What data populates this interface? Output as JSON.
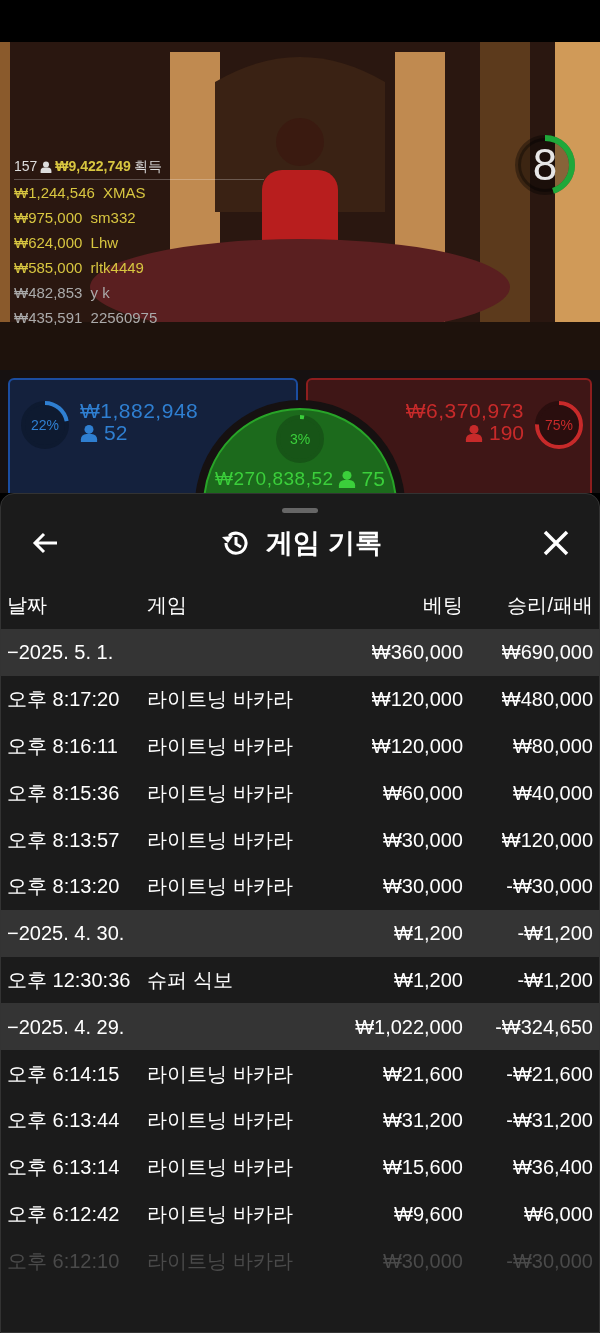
{
  "stream": {
    "timer": {
      "value": "8",
      "level": 0.45
    },
    "leaderboard": {
      "players": "157",
      "total": "₩9,422,749",
      "label": "획득",
      "entries": [
        {
          "amount": "₩1,244,546",
          "name": "XMAS",
          "faded": false
        },
        {
          "amount": "₩975,000",
          "name": "sm332",
          "faded": false
        },
        {
          "amount": "₩624,000",
          "name": "Lhw",
          "faded": false
        },
        {
          "amount": "₩585,000",
          "name": "rltk4449",
          "faded": false
        },
        {
          "amount": "₩482,853",
          "name": "y k",
          "faded": true
        },
        {
          "amount": "₩435,591",
          "name": "22560975",
          "faded": true
        }
      ]
    }
  },
  "bets": [
    {
      "kind": "player",
      "percent": "22%",
      "level": 0.22,
      "amount": "₩1,882,948",
      "count": "52"
    },
    {
      "kind": "tie",
      "percent": "3%",
      "level": 0.03,
      "amount": "₩270,838,52",
      "count": "75"
    },
    {
      "kind": "banker",
      "percent": "75%",
      "level": 0.75,
      "amount": "₩6,370,973",
      "count": "190"
    }
  ],
  "history": {
    "title": "게임 기록",
    "columns": [
      "날짜",
      "게임",
      "베팅",
      "승리/패배"
    ],
    "groups": [
      {
        "date": "−2025. 5. 1.",
        "bet": "₩360,000",
        "result": "₩690,000",
        "games": [
          {
            "time": "오후 8:17:20",
            "game": "라이트닝 바카라",
            "bet": "₩120,000",
            "result": "₩480,000",
            "faded": false
          },
          {
            "time": "오후 8:16:11",
            "game": "라이트닝 바카라",
            "bet": "₩120,000",
            "result": "₩80,000",
            "faded": false
          },
          {
            "time": "오후 8:15:36",
            "game": "라이트닝 바카라",
            "bet": "₩60,000",
            "result": "₩40,000",
            "faded": false
          },
          {
            "time": "오후 8:13:57",
            "game": "라이트닝 바카라",
            "bet": "₩30,000",
            "result": "₩120,000",
            "faded": false
          },
          {
            "time": "오후 8:13:20",
            "game": "라이트닝 바카라",
            "bet": "₩30,000",
            "result": "-₩30,000",
            "faded": false
          }
        ]
      },
      {
        "date": "−2025. 4. 30.",
        "bet": "₩1,200",
        "result": "-₩1,200",
        "games": [
          {
            "time": "오후 12:30:36",
            "game": "슈퍼 식보",
            "bet": "₩1,200",
            "result": "-₩1,200",
            "faded": false
          }
        ]
      },
      {
        "date": "−2025. 4. 29.",
        "bet": "₩1,022,000",
        "result": "-₩324,650",
        "games": [
          {
            "time": "오후 6:14:15",
            "game": "라이트닝 바카라",
            "bet": "₩21,600",
            "result": "-₩21,600",
            "faded": false
          },
          {
            "time": "오후 6:13:44",
            "game": "라이트닝 바카라",
            "bet": "₩31,200",
            "result": "-₩31,200",
            "faded": false
          },
          {
            "time": "오후 6:13:14",
            "game": "라이트닝 바카라",
            "bet": "₩15,600",
            "result": "₩36,400",
            "faded": false
          },
          {
            "time": "오후 6:12:42",
            "game": "라이트닝 바카라",
            "bet": "₩9,600",
            "result": "₩6,000",
            "faded": false
          },
          {
            "time": "오후 6:12:10",
            "game": "라이트닝 바카라",
            "bet": "₩30,000",
            "result": "-₩30,000",
            "faded": true
          }
        ]
      }
    ]
  }
}
